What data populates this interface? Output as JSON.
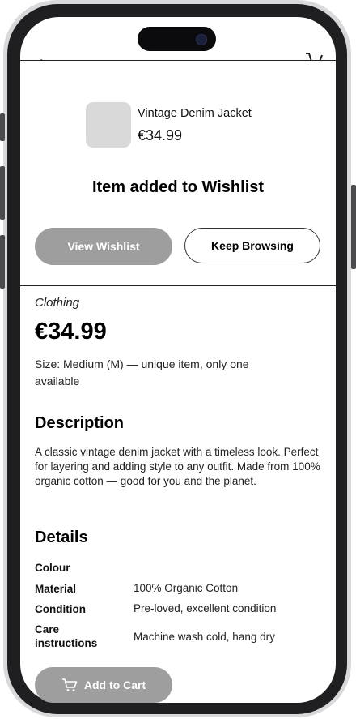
{
  "modal": {
    "product_name": "Vintage Denim Jacket",
    "product_price": "€34.99",
    "message": "Item added to Wishlist",
    "view_wishlist_label": "View Wishlist",
    "keep_browsing_label": "Keep Browsing"
  },
  "product": {
    "category": "Clothing",
    "price": "€34.99",
    "size_note": "Size: Medium (M) — unique item, only one available"
  },
  "description": {
    "heading": "Description",
    "text": "A classic vintage denim jacket with a timeless look. Perfect for layering and adding style to any outfit. Made from 100% organic cotton — good for you and the planet."
  },
  "details": {
    "heading": "Details",
    "rows": [
      {
        "label": "Colour",
        "value": ""
      },
      {
        "label": "Material",
        "value": "100% Organic Cotton"
      },
      {
        "label": "Condition",
        "value": "Pre-loved, excellent condition"
      },
      {
        "label": "Care instructions",
        "value": "Machine wash cold, hang dry"
      }
    ]
  },
  "actions": {
    "add_to_cart_label": "Add to Cart"
  },
  "icons": {
    "back": "back-arrow-icon",
    "cart": "cart-icon"
  }
}
